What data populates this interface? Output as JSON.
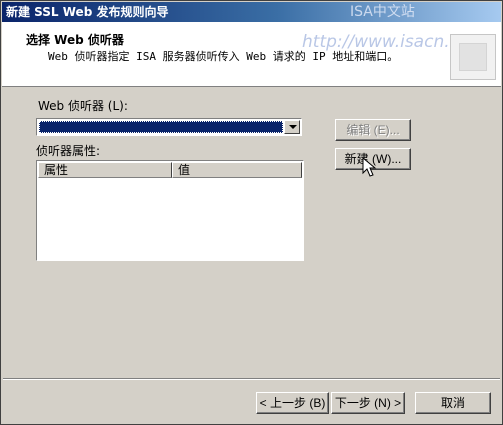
{
  "window": {
    "title": "新建 SSL Web 发布规则向导",
    "watermark_top": "ISA中文站",
    "watermark_url": "http://www.isacn.org"
  },
  "header": {
    "heading": "选择 Web 侦听器",
    "subheading": "Web 侦听器指定 ISA 服务器侦听传入 Web 请求的 IP 地址和端口。"
  },
  "listener": {
    "label": "Web 侦听器 (L):",
    "selected_value": "",
    "edit_button": "编辑 (E)...",
    "new_button": "新建 (W)..."
  },
  "properties": {
    "label": "侦听器属性:",
    "columns": [
      "属性",
      "值"
    ]
  },
  "footer": {
    "back": "< 上一步 (B)",
    "next": "下一步 (N) >",
    "cancel": "取消"
  },
  "colors": {
    "selection": "#0a246a",
    "titlebar_start": "#0a246a",
    "face": "#d4d0c8"
  }
}
